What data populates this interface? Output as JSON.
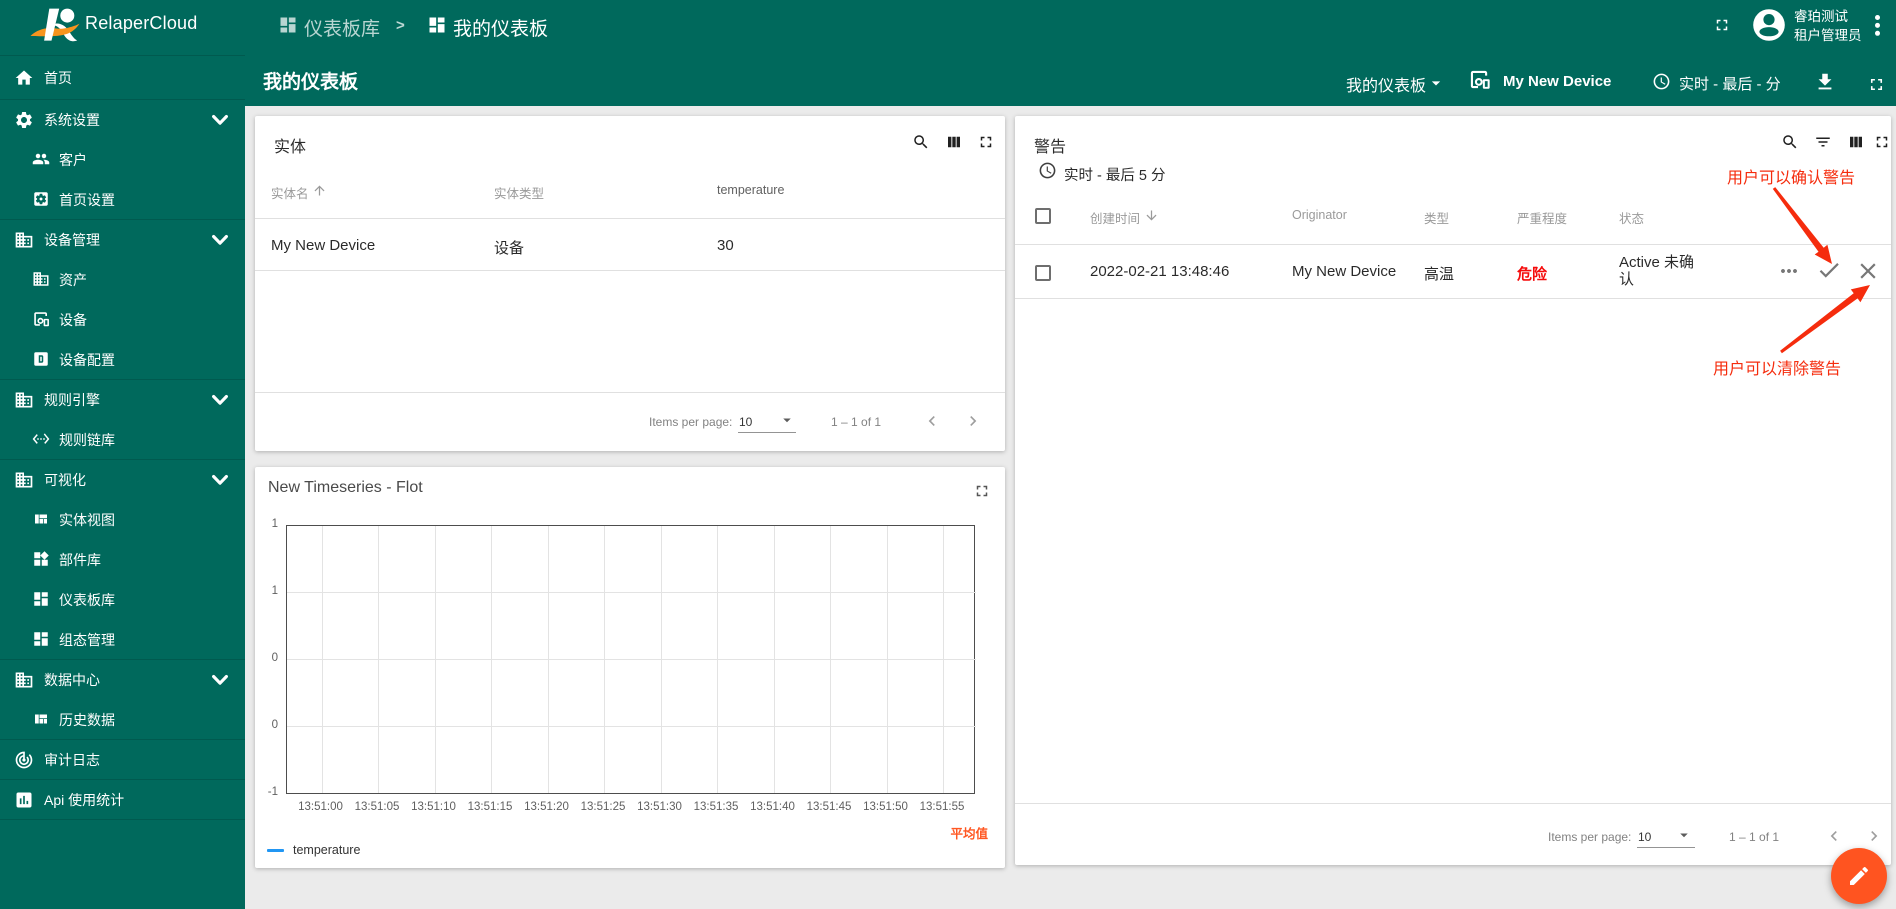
{
  "app": {
    "name": "RelaperCloud"
  },
  "colors": {
    "primary": "#00695c",
    "content_bg": "#ebebeb",
    "fab_orange": "#ff5420",
    "annotation_red": "#f52c0d",
    "severity_red": "#f50b0b",
    "series_blue": "#2196f3",
    "aggregation_orange": "#ff5722"
  },
  "topbar": {
    "breadcrumb": [
      {
        "icon": "dashboard-icon",
        "label": "仪表板库"
      },
      {
        "icon": "dashboard-icon",
        "label": "我的仪表板"
      }
    ],
    "breadcrumb_separator": ">",
    "user": {
      "name": "睿珀测试",
      "role": "租户管理员"
    }
  },
  "toolbar": {
    "page_title": "我的仪表板",
    "state_select_label": "我的仪表板",
    "device_button_label": "My New Device",
    "timewindow_label": "实时 - 最后 - 分"
  },
  "sidebar": {
    "items": [
      {
        "label": "首页",
        "icon": "home-icon",
        "level": 0,
        "chevron": false,
        "sep_after": true,
        "home": true
      },
      {
        "label": "系统设置",
        "icon": "gear-icon",
        "level": 0,
        "chevron": true,
        "sep_after": false
      },
      {
        "label": "客户",
        "icon": "people-icon",
        "level": 1,
        "chevron": false,
        "sep_after": false
      },
      {
        "label": "首页设置",
        "icon": "settings-box-icon",
        "level": 1,
        "chevron": false,
        "sep_after": true
      },
      {
        "label": "设备管理",
        "icon": "building-icon",
        "level": 0,
        "chevron": true,
        "sep_after": false
      },
      {
        "label": "资产",
        "icon": "building-icon",
        "level": 1,
        "chevron": false,
        "sep_after": false
      },
      {
        "label": "设备",
        "icon": "devices-icon",
        "level": 1,
        "chevron": false,
        "sep_after": false
      },
      {
        "label": "设备配置",
        "icon": "alpha-d-box-icon",
        "level": 1,
        "chevron": false,
        "sep_after": true
      },
      {
        "label": "规则引擎",
        "icon": "building-icon",
        "level": 0,
        "chevron": true,
        "sep_after": false
      },
      {
        "label": "规则链库",
        "icon": "settings-ethernet-icon",
        "level": 1,
        "chevron": false,
        "sep_after": true
      },
      {
        "label": "可视化",
        "icon": "building-icon",
        "level": 0,
        "chevron": true,
        "sep_after": false
      },
      {
        "label": "实体视图",
        "icon": "view-quilt-icon",
        "level": 1,
        "chevron": false,
        "sep_after": false
      },
      {
        "label": "部件库",
        "icon": "widgets-icon",
        "level": 1,
        "chevron": false,
        "sep_after": false
      },
      {
        "label": "仪表板库",
        "icon": "dashboard-icon",
        "level": 1,
        "chevron": false,
        "sep_after": false
      },
      {
        "label": "组态管理",
        "icon": "dashboard-icon",
        "level": 1,
        "chevron": false,
        "sep_after": true
      },
      {
        "label": "数据中心",
        "icon": "building-icon",
        "level": 0,
        "chevron": true,
        "sep_after": false
      },
      {
        "label": "历史数据",
        "icon": "view-quilt-icon",
        "level": 1,
        "chevron": false,
        "sep_after": true
      },
      {
        "label": "审计日志",
        "icon": "track-changes-icon",
        "level": 0,
        "chevron": false,
        "sep_after": true
      },
      {
        "label": "Api 使用统计",
        "icon": "insert-chart-icon",
        "level": 0,
        "chevron": false,
        "sep_after": true
      }
    ]
  },
  "entities_card": {
    "title": "实体",
    "columns": [
      "实体名",
      "实体类型",
      "temperature"
    ],
    "rows": [
      [
        "My New Device",
        "设备",
        "30"
      ]
    ],
    "paginator": {
      "items_per_page_label": "Items per page:",
      "page_size": "10",
      "range_label": "1 – 1 of 1"
    }
  },
  "alarms_card": {
    "title": "警告",
    "timewindow_label": "实时 - 最后 5 分",
    "columns": [
      "创建时间",
      "Originator",
      "类型",
      "严重程度",
      "状态"
    ],
    "rows": [
      {
        "created_time": "2022-02-21 13:48:46",
        "originator": "My New Device",
        "type": "高温",
        "severity": "危险",
        "status_line1": "Active 未确",
        "status_line2": "认"
      }
    ],
    "paginator": {
      "items_per_page_label": "Items per page:",
      "page_size": "10",
      "range_label": "1 – 1 of 1"
    }
  },
  "annotations": {
    "ack_label": "用户可以确认警告",
    "clear_label": "用户可以清除警告"
  },
  "chart_card": {
    "title": "New Timeseries - Flot",
    "legend": [
      {
        "label": "temperature",
        "color": "#2196f3"
      }
    ],
    "aggregation_label": "平均值"
  },
  "chart_data": {
    "type": "line",
    "title": "New Timeseries - Flot",
    "series": [
      {
        "name": "temperature",
        "color": "#2196f3",
        "values": []
      }
    ],
    "x_ticks": [
      "13:51:00",
      "13:51:05",
      "13:51:10",
      "13:51:15",
      "13:51:20",
      "13:51:25",
      "13:51:30",
      "13:51:35",
      "13:51:40",
      "13:51:45",
      "13:51:50",
      "13:51:55"
    ],
    "y_tick_labels": [
      "1",
      "1",
      "0",
      "0",
      "-1"
    ],
    "ylim": [
      -1,
      1
    ],
    "grid": true,
    "legend_position": "bottom-left"
  }
}
